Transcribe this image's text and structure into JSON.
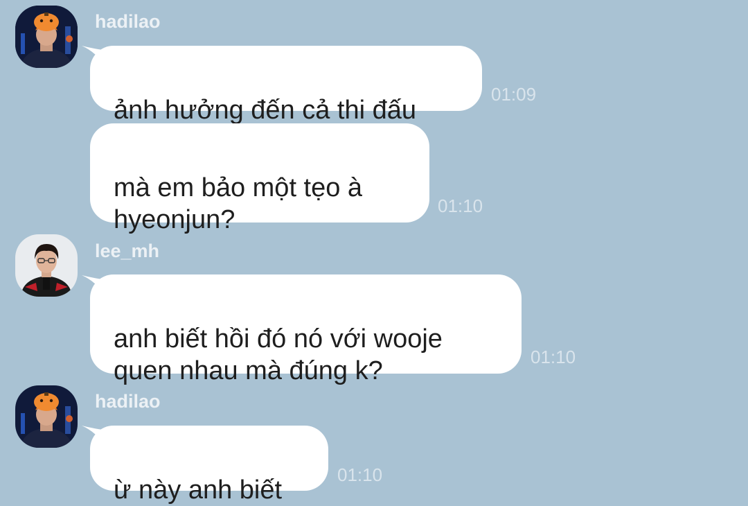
{
  "messages": [
    {
      "sender": "hadilao",
      "avatar": "hadilao-avatar",
      "text": "ảnh hưởng đến cả thi đấu",
      "time": "01:09"
    },
    {
      "sender": "",
      "text": "mà em bảo một tẹo à\nhyeonjun?",
      "time": "01:10"
    },
    {
      "sender": "lee_mh",
      "avatar": "lee_mh-avatar",
      "text": "anh biết hồi đó nó với wooje\nquen nhau mà đúng k?",
      "time": "01:10"
    },
    {
      "sender": "hadilao",
      "avatar": "hadilao-avatar",
      "text": "ừ này anh biết",
      "time": "01:10"
    }
  ],
  "colors": {
    "background": "#a9c2d3",
    "bubble": "#ffffff",
    "text": "#1e1e1e",
    "meta": "#ecf1f5"
  }
}
